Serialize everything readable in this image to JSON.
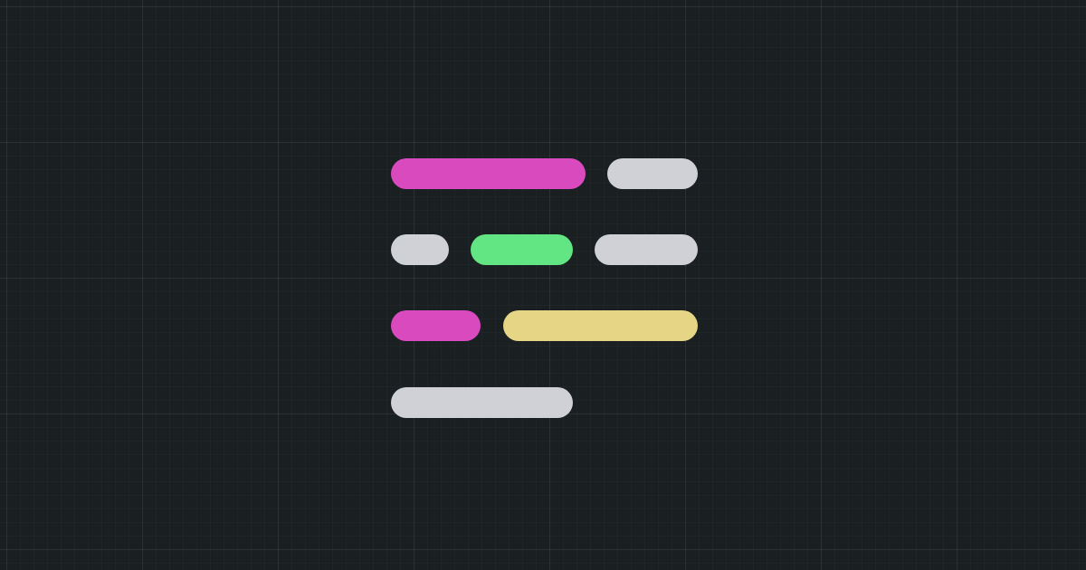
{
  "colors": {
    "background": "#1a1f21",
    "grid_line": "#2a3133",
    "magenta": "#da4abf",
    "gray": "#cfd1d6",
    "green": "#62e583",
    "yellow": "#e5d585"
  },
  "code_glyph": {
    "lines": [
      {
        "tokens": [
          "magenta",
          "gray"
        ]
      },
      {
        "tokens": [
          "gray",
          "green",
          "gray"
        ]
      },
      {
        "tokens": [
          "magenta",
          "yellow"
        ]
      },
      {
        "tokens": [
          "gray"
        ]
      }
    ]
  }
}
